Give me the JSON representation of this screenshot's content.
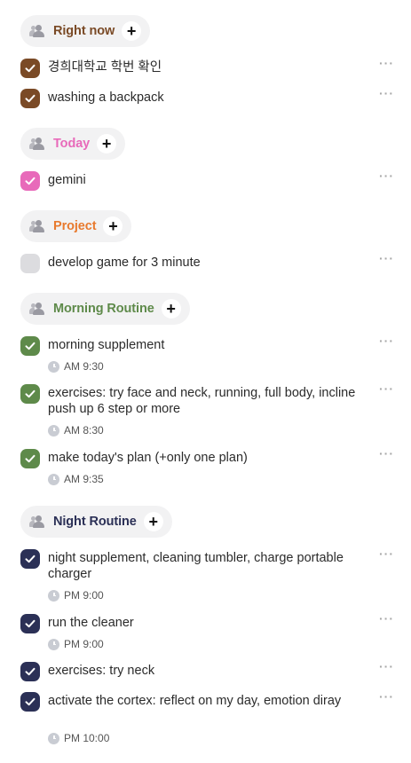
{
  "groups": [
    {
      "id": "right_now",
      "title": "Right now",
      "color": "#7a4a26",
      "plus": "+",
      "tasks": [
        {
          "text": "경희대학교 학번 확인",
          "checked": true,
          "more": "···"
        },
        {
          "text": "washing a backpack",
          "checked": true,
          "more": "···"
        }
      ]
    },
    {
      "id": "today",
      "title": "Today",
      "color": "#e86aba",
      "plus": "+",
      "tasks": [
        {
          "text": "gemini",
          "checked": true,
          "more": "···"
        }
      ]
    },
    {
      "id": "project",
      "title": "Project",
      "color": "#e87a2e",
      "plus": "+",
      "tasks": [
        {
          "text": "develop game for 3 minute",
          "checked": false,
          "more": "···"
        }
      ]
    },
    {
      "id": "morning",
      "title": "Morning Routine",
      "color": "#5e8a4a",
      "plus": "+",
      "tasks": [
        {
          "text": "morning supplement",
          "checked": true,
          "time": "AM 9:30",
          "more": "···"
        },
        {
          "text": "exercises: try face and neck, running, full body, incline push up 6 step or more",
          "checked": true,
          "time": "AM 8:30",
          "more": "···"
        },
        {
          "text": "make today's plan (+only one plan)",
          "checked": true,
          "time": "AM 9:35",
          "more": "···"
        }
      ]
    },
    {
      "id": "night",
      "title": "Night Routine",
      "color": "#2b3056",
      "plus": "+",
      "tasks": [
        {
          "text": "night supplement, cleaning tumbler, charge portable charger",
          "checked": true,
          "time": "PM 9:00",
          "more": "···"
        },
        {
          "text": "run the cleaner",
          "checked": true,
          "time": "PM 9:00",
          "more": "···"
        },
        {
          "text": "exercises: try neck",
          "checked": true,
          "more": "···"
        },
        {
          "text": "activate the cortex: reflect on my day, emotion diray",
          "checked": true,
          "time": "PM 10:00",
          "more": "···"
        }
      ]
    }
  ],
  "colors": {
    "unchecked": "#dcdcdf",
    "more": "#a8a8a8",
    "clock": "#c9ccd3"
  }
}
